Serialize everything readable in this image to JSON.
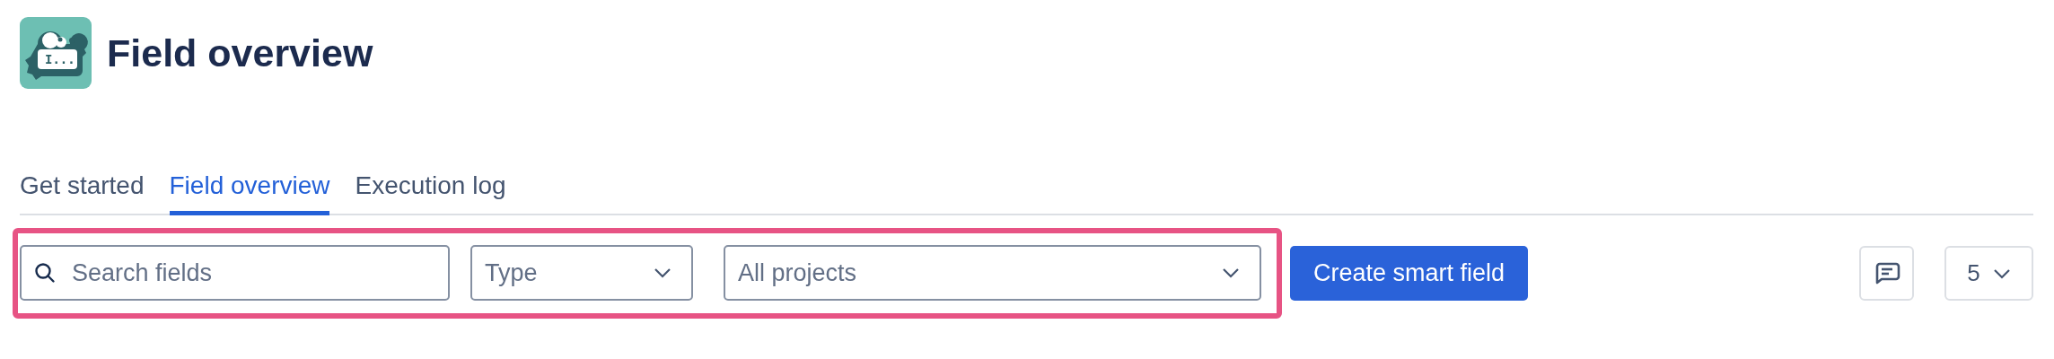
{
  "header": {
    "logo_text": "I...",
    "title": "Field overview"
  },
  "tabs": [
    {
      "label": "Get started",
      "selected": false
    },
    {
      "label": "Field overview",
      "selected": true
    },
    {
      "label": "Execution log",
      "selected": false
    }
  ],
  "search": {
    "placeholder": "Search fields"
  },
  "filters": [
    {
      "label": "Type"
    },
    {
      "label": "All projects"
    }
  ],
  "create_button": "Create smart field",
  "page_size": {
    "value": "5"
  }
}
